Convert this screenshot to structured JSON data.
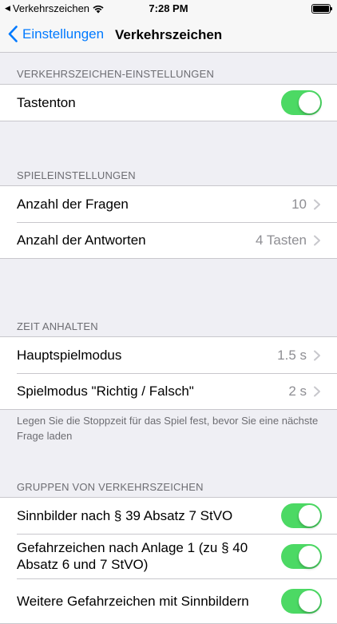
{
  "status_bar": {
    "back_app": "Verkehrszeichen",
    "time": "7:28 PM",
    "back_icon": "back-triangle-icon",
    "wifi_icon": "wifi-icon",
    "battery_icon": "battery-icon",
    "battery_level": 1.0
  },
  "nav": {
    "back_label": "Einstellungen",
    "title": "Verkehrszeichen"
  },
  "section1": {
    "header": "VERKEHRSZEICHEN-EINSTELLUNGEN",
    "rows": [
      {
        "label": "Tastenton",
        "toggle": true
      }
    ]
  },
  "section2": {
    "header": "SPIELEINSTELLUNGEN",
    "rows": [
      {
        "label": "Anzahl der Fragen",
        "value": "10"
      },
      {
        "label": "Anzahl der Antworten",
        "value": "4 Tasten"
      }
    ]
  },
  "section3": {
    "header": "ZEIT ANHALTEN",
    "rows": [
      {
        "label": "Hauptspielmodus",
        "value": "1.5 s"
      },
      {
        "label": "Spielmodus \"Richtig / Falsch\"",
        "value": "2 s"
      }
    ],
    "footer": "Legen Sie die Stoppzeit für das Spiel fest, bevor Sie eine nächste Frage laden"
  },
  "section4": {
    "header": "GRUPPEN VON VERKEHRSZEICHEN",
    "rows": [
      {
        "label": "Sinnbilder nach § 39 Absatz 7 StVO",
        "toggle": true
      },
      {
        "label": "Gefahrzeichen nach Anlage 1 (zu § 40 Absatz 6 und 7 StVO)",
        "toggle": true
      },
      {
        "label": "Weitere Gefahrzeichen mit Sinnbildern",
        "toggle": true
      }
    ]
  },
  "colors": {
    "accent": "#007aff",
    "toggle_on": "#4cd964",
    "background": "#efeff4"
  }
}
